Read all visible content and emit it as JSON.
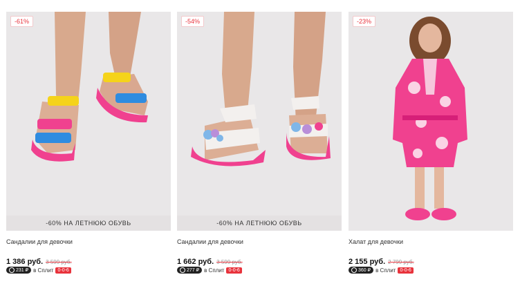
{
  "products": [
    {
      "discount": "-61%",
      "promo": "-60% НА ЛЕТНЮЮ ОБУВЬ",
      "name": "Сандалии для девочки",
      "price": "1 386 руб.",
      "old_price": "3 599 руб.",
      "split_amount": "231 ₽",
      "split_label": "в Сплит",
      "split_tag": "0-0-6",
      "image": "girl-legs-sandals-pink-yellow-blue"
    },
    {
      "discount": "-54%",
      "promo": "-60% НА ЛЕТНЮЮ ОБУВЬ",
      "name": "Сандалии для девочки",
      "price": "1 662 руб.",
      "old_price": "3 599 руб.",
      "split_amount": "277 ₽",
      "split_label": "в Сплит",
      "split_tag": "0-0-6",
      "image": "girl-legs-white-sandals-butterflies"
    },
    {
      "discount": "-23%",
      "promo": "",
      "name": "Халат для девочки",
      "price": "2 155 руб.",
      "old_price": "2 799 руб.",
      "split_amount": "360 ₽",
      "split_label": "в Сплит",
      "split_tag": "0-0-6",
      "image": "girl-pink-bathrobe"
    }
  ],
  "colors": {
    "discount": "#e8333c",
    "background": "#e9e7e8",
    "pink": "#f0418f"
  }
}
